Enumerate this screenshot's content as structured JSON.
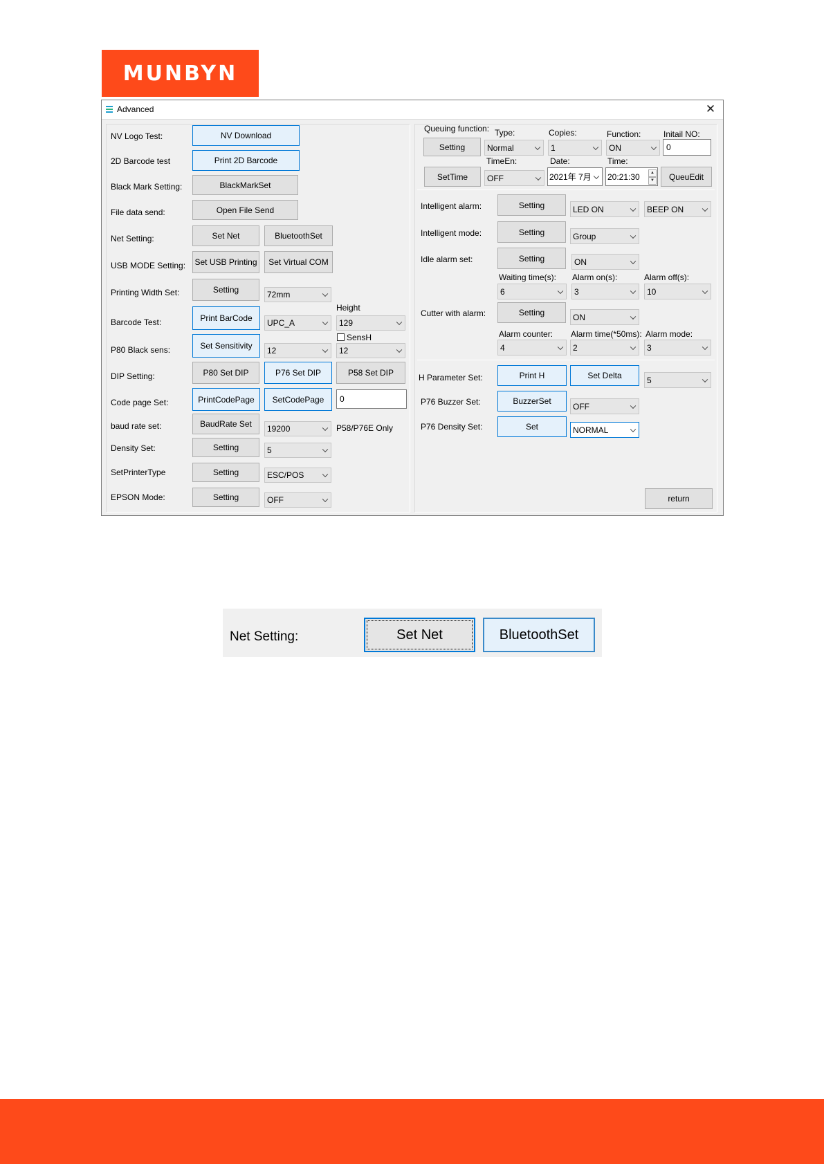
{
  "brand": {
    "logo_text": "MUNBYN",
    "accent_color": "#fe4a1a"
  },
  "window": {
    "title": "Advanced",
    "close_label": "✕",
    "left": {
      "nv_logo_label": "NV Logo Test:",
      "nv_download_button": "NV Download",
      "barcode2d_label": "2D Barcode test",
      "print_2d_button": "Print 2D Barcode",
      "black_mark_label": "Black Mark Setting:",
      "black_mark_button": "BlackMarkSet",
      "file_send_label": "File data send:",
      "open_file_button": "Open File Send",
      "net_label": "Net Setting:",
      "set_net_button": "Set Net",
      "bluetooth_button": "BluetoothSet",
      "usb_mode_label": "USB MODE Setting:",
      "usb_printing_button": "Set USB Printing",
      "virtual_com_button": "Set Virtual COM",
      "width_label": "Printing Width Set:",
      "width_button": "Setting",
      "width_value": "72mm",
      "height_label": "Height",
      "barcode_label": "Barcode Test:",
      "print_barcode_button": "Print BarCode",
      "barcode_type": "UPC_A",
      "barcode_height": "129",
      "sensh_label": "SensH",
      "black_sens_label": "P80 Black sens:",
      "sensitivity_button": "Set Sensitivity",
      "sensitivity_value": "12",
      "sensh_value": "12",
      "dip_label": "DIP Setting:",
      "p80_dip_button": "P80 Set DIP",
      "p76_dip_button": "P76 Set DIP",
      "p58_dip_button": "P58 Set DIP",
      "code_page_label": "Code page Set:",
      "print_code_page_button": "PrintCodePage",
      "set_code_page_button": "SetCodePage",
      "code_page_value": "0",
      "baud_label": "baud rate set:",
      "baud_button": "BaudRate Set",
      "baud_value": "19200",
      "baud_note": "P58/P76E Only",
      "density_label": "Density Set:",
      "density_button": "Setting",
      "density_value": "5",
      "printer_type_label": "SetPrinterType",
      "printer_type_button": "Setting",
      "printer_type_value": "ESC/POS",
      "epson_label": "EPSON Mode:",
      "epson_button": "Setting",
      "epson_value": "OFF"
    },
    "right": {
      "queuing_label": "Queuing function:",
      "type_label": "Type:",
      "copies_label": "Copies:",
      "function_label": "Function:",
      "initial_no_label": "Initail NO:",
      "queuing_button": "Setting",
      "type_value": "Normal",
      "copies_value": "1",
      "function_value": "ON",
      "initial_no_value": "0",
      "timeen_label": "TimeEn:",
      "date_label": "Date:",
      "time_label": "Time:",
      "settime_button": "SetTime",
      "timeen_value": "OFF",
      "date_value": "2021年  7月",
      "time_value": "20:21:30",
      "queuedit_button": "QueuEdit",
      "intel_alarm_label": "Intelligent alarm:",
      "intel_alarm_button": "Setting",
      "led_value": "LED ON",
      "beep_value": "BEEP ON",
      "intel_mode_label": "Intelligent mode:",
      "intel_mode_button": "Setting",
      "intel_mode_value": "Group",
      "idle_alarm_label": "Idle alarm set:",
      "idle_alarm_button": "Setting",
      "idle_alarm_value": "ON",
      "waiting_label": "Waiting time(s):",
      "alarm_on_label": "Alarm on(s):",
      "alarm_off_label": "Alarm off(s):",
      "waiting_value": "6",
      "alarm_on_value": "3",
      "alarm_off_value": "10",
      "cutter_label": "Cutter with alarm:",
      "cutter_button": "Setting",
      "cutter_value": "ON",
      "counter_label": "Alarm counter:",
      "alarm_time_label": "Alarm time(*50ms):",
      "alarm_mode_label": "Alarm mode:",
      "counter_value": "4",
      "alarm_time_value": "2",
      "alarm_mode_value": "3",
      "h_param_label": "H Parameter Set:",
      "print_h_button": "Print H",
      "set_delta_button": "Set Delta",
      "delta_value": "5",
      "buzzer_label": "P76 Buzzer Set:",
      "buzzer_button": "BuzzerSet",
      "buzzer_value": "OFF",
      "p76_density_label": "P76 Density Set:",
      "p76_density_button": "Set",
      "p76_density_value": "NORMAL",
      "return_button": "return"
    }
  },
  "zoom": {
    "label": "Net Setting:",
    "set_net_button": "Set Net",
    "bluetooth_button": "BluetoothSet"
  }
}
